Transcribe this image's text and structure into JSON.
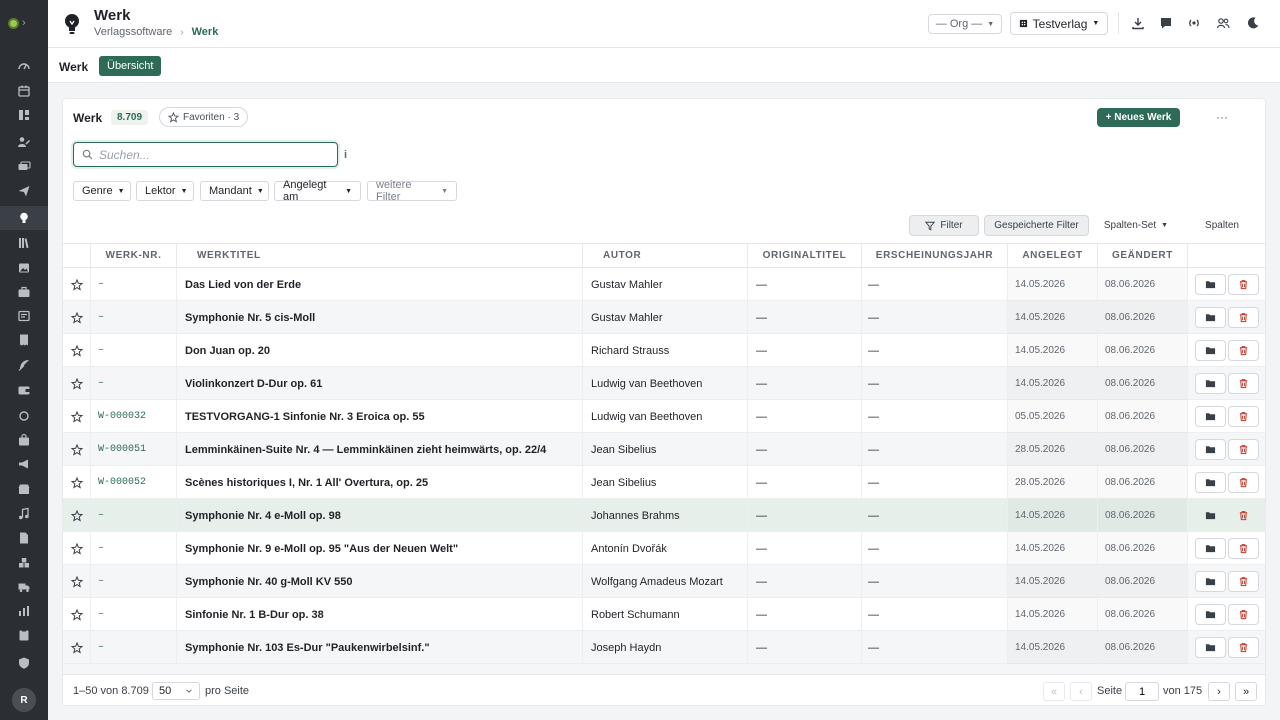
{
  "header": {
    "app_title": "Werk",
    "breadcrumb": [
      "Verlagssoftware",
      "Werk"
    ],
    "org_select": "— Org —",
    "publisher_select": "Testverlag",
    "icons": [
      "download-icon",
      "chat-icon",
      "broadcast-icon",
      "users-icon",
      "moon-icon"
    ]
  },
  "rail": {
    "icons": [
      "gauge-icon",
      "calendar-icon",
      "board-icon",
      "person-edit-icon",
      "tickets-icon",
      "send-icon",
      "bulb-icon",
      "library-icon",
      "image-icon",
      "briefcase-icon",
      "reader-icon",
      "receipt-icon",
      "feather-icon",
      "wallet-icon",
      "circle-icon",
      "bag-icon",
      "megaphone-icon",
      "store-icon",
      "music-icon",
      "file-icon",
      "boxes-icon",
      "truck-icon",
      "chart-icon",
      "clipboard-icon",
      "shield-icon"
    ],
    "active_index": 6,
    "avatar_letter": "R"
  },
  "subbar": {
    "title": "Werk",
    "tab": "Übersicht"
  },
  "card": {
    "title": "Werk",
    "count": "8.709",
    "favorites": "Favoriten · 3",
    "new_button": "+ Neues Werk",
    "more": "···",
    "search_placeholder": "Suchen...",
    "info": "i",
    "facets": [
      "Genre",
      "Lektor",
      "Mandant",
      "Angelegt am",
      "weitere Filter"
    ],
    "filter_button": "Filter",
    "saved_filter": "Gespeicherte Filter",
    "columns_set": "Spalten-Set",
    "columns": "Spalten"
  },
  "table": {
    "headers": [
      "Werk-Nr.",
      "Werktitel",
      "Autor",
      "Originaltitel",
      "Erscheinungsjahr",
      "Angelegt",
      "Geändert"
    ],
    "rows": [
      {
        "nr": "–",
        "title": "Das Lied von der Erde",
        "autor": "Gustav Mahler",
        "orig": "—",
        "jahr": "—",
        "angelegt": "14.05.2026",
        "geaendert": "08.06.2026"
      },
      {
        "nr": "–",
        "title": "Symphonie Nr. 5 cis-Moll",
        "autor": "Gustav Mahler",
        "orig": "—",
        "jahr": "—",
        "angelegt": "14.05.2026",
        "geaendert": "08.06.2026"
      },
      {
        "nr": "–",
        "title": "Don Juan op. 20",
        "autor": "Richard Strauss",
        "orig": "—",
        "jahr": "—",
        "angelegt": "14.05.2026",
        "geaendert": "08.06.2026"
      },
      {
        "nr": "–",
        "title": "Violinkonzert D-Dur op. 61",
        "autor": "Ludwig van Beethoven",
        "orig": "—",
        "jahr": "—",
        "angelegt": "14.05.2026",
        "geaendert": "08.06.2026"
      },
      {
        "nr": "W-000032",
        "title": "TESTVORGANG-1 Sinfonie Nr. 3 Eroica op. 55",
        "autor": "Ludwig van Beethoven",
        "orig": "—",
        "jahr": "—",
        "angelegt": "05.05.2026",
        "geaendert": "08.06.2026"
      },
      {
        "nr": "W-000051",
        "title": "Lemminkäinen-Suite Nr. 4 — Lemminkäinen zieht heimwärts, op. 22/4",
        "autor": "Jean Sibelius",
        "orig": "—",
        "jahr": "—",
        "angelegt": "28.05.2026",
        "geaendert": "08.06.2026"
      },
      {
        "nr": "W-000052",
        "title": "Scènes historiques I, Nr. 1 All' Overtura, op. 25",
        "autor": "Jean Sibelius",
        "orig": "—",
        "jahr": "—",
        "angelegt": "28.05.2026",
        "geaendert": "08.06.2026"
      },
      {
        "nr": "–",
        "title": "Symphonie Nr. 4 e-Moll op. 98",
        "autor": "Johannes Brahms",
        "orig": "—",
        "jahr": "—",
        "angelegt": "14.05.2026",
        "geaendert": "08.06.2026"
      },
      {
        "nr": "–",
        "title": "Symphonie Nr. 9 e-Moll op. 95 \"Aus der Neuen Welt\"",
        "autor": "Antonín Dvořák",
        "orig": "—",
        "jahr": "—",
        "angelegt": "14.05.2026",
        "geaendert": "08.06.2026"
      },
      {
        "nr": "–",
        "title": "Symphonie Nr. 40 g-Moll KV 550",
        "autor": "Wolfgang Amadeus Mozart",
        "orig": "—",
        "jahr": "—",
        "angelegt": "14.05.2026",
        "geaendert": "08.06.2026"
      },
      {
        "nr": "–",
        "title": "Sinfonie Nr. 1 B-Dur op. 38",
        "autor": "Robert Schumann",
        "orig": "—",
        "jahr": "—",
        "angelegt": "14.05.2026",
        "geaendert": "08.06.2026"
      },
      {
        "nr": "–",
        "title": "Symphonie Nr. 103 Es-Dur \"Paukenwirbelsinf.\"",
        "autor": "Joseph Haydn",
        "orig": "—",
        "jahr": "—",
        "angelegt": "14.05.2026",
        "geaendert": "08.06.2026"
      }
    ],
    "selected_row": 7
  },
  "footer": {
    "range": "1–50 von 8.709",
    "per_page": "50",
    "per_label": "pro Seite",
    "page_label": "Seite",
    "page": "1",
    "of_pages": "von 175",
    "first": "«",
    "prev": "‹",
    "next": "›",
    "last": "»"
  },
  "colors": {
    "accent": "#2e6b57",
    "danger": "#c0392b",
    "rail": "#2b2f34",
    "selected_row": "#e6efea"
  }
}
